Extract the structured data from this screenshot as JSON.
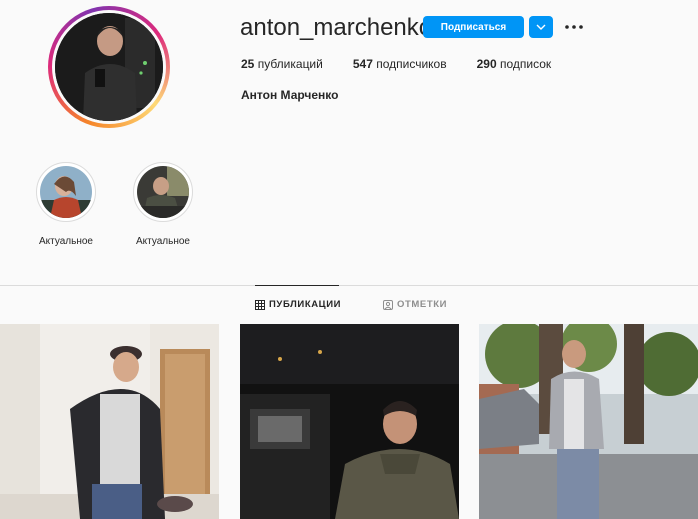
{
  "profile": {
    "username": "anton_marchenkoo",
    "follow_label": "Подписаться",
    "full_name": "Антон Марченко",
    "stats": {
      "posts_count": "25",
      "posts_label": "публикаций",
      "followers_count": "547",
      "followers_label": "подписчиков",
      "following_count": "290",
      "following_label": "подписок"
    }
  },
  "highlights": [
    {
      "label": "Актуальное"
    },
    {
      "label": "Актуальное"
    }
  ],
  "tabs": {
    "posts": "ПУБЛИКАЦИИ",
    "tagged": "ОТМЕТКИ"
  },
  "colors": {
    "accent": "#0095f6",
    "text": "#262626",
    "muted": "#8e8e8e",
    "background": "#fafafa"
  },
  "icons": {
    "more": "more-dots-icon",
    "dropdown": "chevron-down-icon",
    "posts_tab": "grid-icon",
    "tagged_tab": "tag-person-icon"
  }
}
